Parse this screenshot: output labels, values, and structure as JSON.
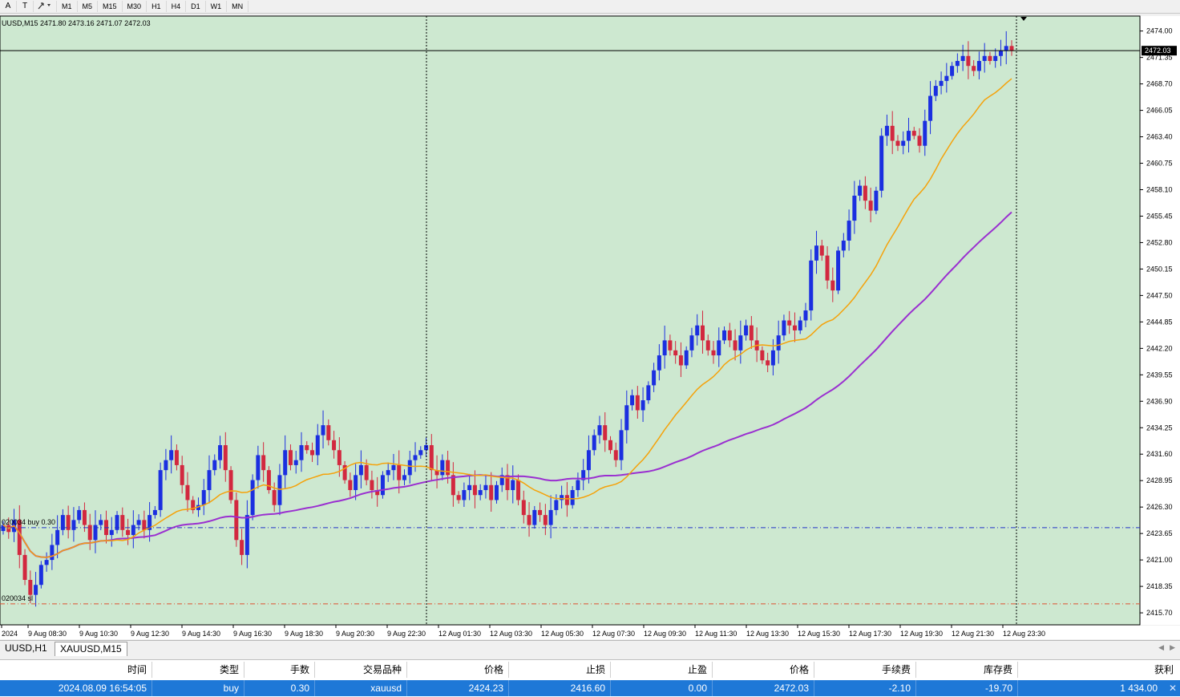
{
  "toolbar": {
    "icons": [
      "A",
      "T",
      "arrow-tool"
    ],
    "timeframes": [
      "M1",
      "M5",
      "M15",
      "M30",
      "H1",
      "H4",
      "D1",
      "W1",
      "MN"
    ]
  },
  "chart": {
    "header": "UUSD,M15  2471.80 2473.16 2471.07 2472.03",
    "current_price": "2472.03",
    "price_ticks": [
      "2474.00",
      "2471.35",
      "2468.70",
      "2466.05",
      "2463.40",
      "2460.75",
      "2458.10",
      "2455.45",
      "2452.80",
      "2450.15",
      "2447.50",
      "2444.85",
      "2442.20",
      "2439.55",
      "2436.90",
      "2434.25",
      "2431.60",
      "2428.95",
      "2426.30",
      "2423.65",
      "2421.00",
      "2418.35",
      "2415.70"
    ],
    "time_ticks": [
      "2024",
      "9 Aug 08:30",
      "9 Aug 10:30",
      "9 Aug 12:30",
      "9 Aug 14:30",
      "9 Aug 16:30",
      "9 Aug 18:30",
      "9 Aug 20:30",
      "9 Aug 22:30",
      "12 Aug 01:30",
      "12 Aug 03:30",
      "12 Aug 05:30",
      "12 Aug 07:30",
      "12 Aug 09:30",
      "12 Aug 11:30",
      "12 Aug 13:30",
      "12 Aug 15:30",
      "12 Aug 17:30",
      "12 Aug 19:30",
      "12 Aug 21:30",
      "12 Aug 23:30"
    ],
    "order_label": "020034 buy 0.30",
    "sl_label": "020034 sl",
    "order_price": 2424.23,
    "sl_price": 2416.6,
    "colors": {
      "background": "#cde8d0",
      "bull": "#1b2fe0",
      "bear": "#d2283f",
      "ma_fast": "#f5a20a",
      "ma_slow": "#9a2fd0",
      "order_line": "#2230c8",
      "sl_line": "#e05030"
    }
  },
  "chart_data": {
    "type": "candlestick",
    "symbol": "XAUUSD",
    "timeframe": "M15",
    "ylim": [
      2414.5,
      2475.5
    ],
    "close_series": [
      2424.5,
      2423.8,
      2425.0,
      2421.5,
      2419.0,
      2417.5,
      2418.5,
      2420.5,
      2421.0,
      2422.5,
      2424.0,
      2425.5,
      2424.0,
      2425.0,
      2426.0,
      2424.5,
      2423.0,
      2424.5,
      2425.0,
      2423.5,
      2424.0,
      2425.5,
      2424.0,
      2423.5,
      2424.5,
      2425.0,
      2424.0,
      2425.5,
      2426.0,
      2430.0,
      2431.0,
      2432.0,
      2430.5,
      2428.5,
      2427.0,
      2426.0,
      2426.5,
      2428.0,
      2430.0,
      2431.0,
      2432.5,
      2430.0,
      2427.0,
      2423.0,
      2421.5,
      2425.5,
      2429.0,
      2431.5,
      2430.0,
      2428.0,
      2426.5,
      2429.5,
      2432.0,
      2430.5,
      2431.0,
      2432.5,
      2432.0,
      2431.5,
      2433.5,
      2434.5,
      2433.0,
      2432.0,
      2430.5,
      2429.0,
      2428.0,
      2429.5,
      2430.5,
      2429.0,
      2428.0,
      2427.5,
      2429.5,
      2430.0,
      2430.5,
      2429.0,
      2429.5,
      2431.0,
      2431.5,
      2432.0,
      2432.5,
      2430.0,
      2429.5,
      2431.0,
      2429.5,
      2427.5,
      2427.0,
      2428.0,
      2428.5,
      2427.5,
      2428.0,
      2428.5,
      2427.0,
      2428.5,
      2429.5,
      2428.0,
      2429.0,
      2427.0,
      2425.5,
      2424.5,
      2426.0,
      2425.5,
      2424.5,
      2426.0,
      2427.0,
      2427.5,
      2426.5,
      2428.0,
      2429.0,
      2430.0,
      2432.0,
      2433.5,
      2434.5,
      2433.0,
      2432.0,
      2431.0,
      2434.0,
      2436.5,
      2437.5,
      2436.0,
      2437.0,
      2438.5,
      2440.0,
      2441.5,
      2443.0,
      2442.0,
      2441.5,
      2440.5,
      2442.0,
      2443.5,
      2444.5,
      2443.0,
      2442.0,
      2441.5,
      2443.0,
      2444.0,
      2443.0,
      2442.0,
      2443.5,
      2444.5,
      2443.0,
      2442.0,
      2441.0,
      2440.5,
      2442.0,
      2443.5,
      2445.0,
      2444.5,
      2444.0,
      2445.0,
      2446.0,
      2451.0,
      2452.5,
      2451.5,
      2449.0,
      2448.0,
      2452.0,
      2453.0,
      2455.0,
      2457.5,
      2458.5,
      2457.0,
      2456.0,
      2458.0,
      2463.5,
      2464.5,
      2463.0,
      2462.5,
      2463.0,
      2464.0,
      2463.5,
      2462.5,
      2465.0,
      2467.5,
      2468.5,
      2469.0,
      2469.5,
      2470.5,
      2471.0,
      2471.5,
      2470.5,
      2470.0,
      2471.0,
      2471.5,
      2471.0,
      2471.5,
      2472.0,
      2472.5,
      2472.03
    ]
  },
  "tabs": [
    "UUSD,H1",
    "XAUUSD,M15"
  ],
  "table": {
    "headers": [
      "时间",
      "类型",
      "手数",
      "交易品种",
      "价格",
      "止损",
      "止盈",
      "价格",
      "手续费",
      "库存费",
      "获利"
    ],
    "row": [
      "2024.08.09 16:54:05",
      "buy",
      "0.30",
      "xauusd",
      "2424.23",
      "2416.60",
      "0.00",
      "2472.03",
      "-2.10",
      "-19.70",
      "1 434.00"
    ]
  }
}
